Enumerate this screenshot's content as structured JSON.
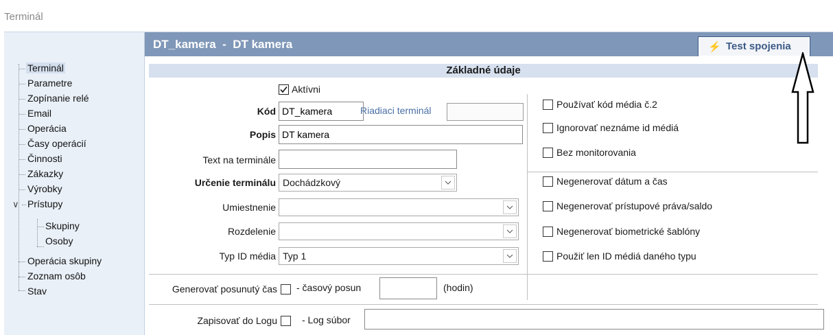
{
  "window": {
    "title": "Terminál"
  },
  "tree": {
    "items": [
      {
        "label": "Terminál"
      },
      {
        "label": "Parametre"
      },
      {
        "label": "Zopínanie relé"
      },
      {
        "label": "Email"
      },
      {
        "label": "Operácia"
      },
      {
        "label": "Časy operácií"
      },
      {
        "label": "Činnosti"
      },
      {
        "label": "Zákazky"
      },
      {
        "label": "Výrobky"
      },
      {
        "label": "Prístupy"
      },
      {
        "label": "Skupiny"
      },
      {
        "label": "Osoby"
      },
      {
        "label": "Operácia skupiny"
      },
      {
        "label": "Zoznam osôb"
      },
      {
        "label": "Stav"
      }
    ]
  },
  "header": {
    "title": "DT_kamera  -  DT kamera",
    "test_button": "Test spojenia"
  },
  "section": {
    "title": "Základné údaje"
  },
  "form": {
    "active_label": "Aktívni",
    "kod_label": "Kód",
    "kod_value": "DT_kamera",
    "riadiaci_label": "Riadiaci terminál",
    "riadiaci_value": "",
    "popis_label": "Popis",
    "popis_value": "DT kamera",
    "text_label": "Text na terminále",
    "text_value": "",
    "urcenie_label": "Určenie terminálu",
    "urcenie_value": "Dochádzkový",
    "umiestnenie_label": "Umiestnenie",
    "umiestnenie_value": "",
    "rozdelenie_label": "Rozdelenie",
    "rozdelenie_value": "",
    "typ_label": "Typ ID média",
    "typ_value": "Typ 1"
  },
  "options": [
    {
      "label": "Používať kód média č.2"
    },
    {
      "label": "Ignorovať neznáme id médiá"
    },
    {
      "label": "Bez monitorovania"
    },
    {
      "label": "Negenerovať dátum a čas"
    },
    {
      "label": "Negenerovať prístupové práva/saldo"
    },
    {
      "label": "Negenerovať biometrické šablóny"
    },
    {
      "label": "Použiť len ID médiá daného typu"
    }
  ],
  "shift": {
    "label": "Generovať posunutý čas",
    "offset_label": "- časový posun",
    "offset_value": "",
    "unit": "(hodin)"
  },
  "log": {
    "label": "Zapisovať do Logu",
    "file_label": "- Log súbor",
    "file_value": ""
  }
}
